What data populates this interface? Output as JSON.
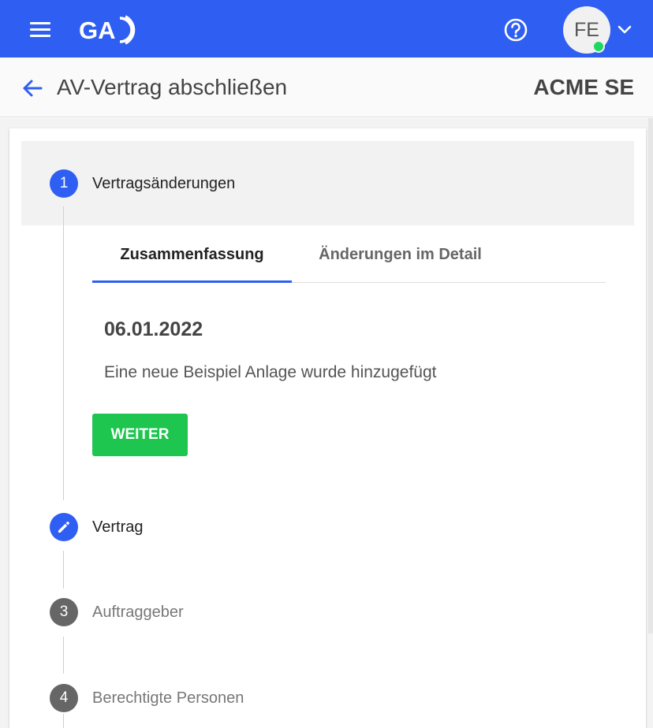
{
  "header": {
    "logo_text": "GA",
    "avatar_initials": "FE"
  },
  "subheader": {
    "title": "AV-Vertrag abschließen",
    "company": "ACME SE"
  },
  "steps": [
    {
      "number": "1",
      "label": "Vertragsänderungen",
      "state": "active"
    },
    {
      "number": "",
      "label": "Vertrag",
      "state": "edit"
    },
    {
      "number": "3",
      "label": "Auftraggeber",
      "state": "inactive"
    },
    {
      "number": "4",
      "label": "Berechtigte Personen",
      "state": "inactive"
    }
  ],
  "tabs": [
    {
      "label": "Zusammenfassung",
      "selected": true
    },
    {
      "label": "Änderungen im Detail",
      "selected": false
    }
  ],
  "summary": {
    "date": "06.01.2022",
    "text": "Eine neue Beispiel Anlage wurde hinzugefügt"
  },
  "actions": {
    "next_label": "WEITER"
  },
  "colors": {
    "primary": "#2f5ff2",
    "success": "#1ec54f",
    "inactive_step": "#666666",
    "online_dot": "#1ed760"
  },
  "icons": {
    "menu": "hamburger-menu-icon",
    "help": "help-circle-icon",
    "dropdown": "chevron-down-icon",
    "back": "arrow-left-icon",
    "edit": "pencil-icon"
  }
}
